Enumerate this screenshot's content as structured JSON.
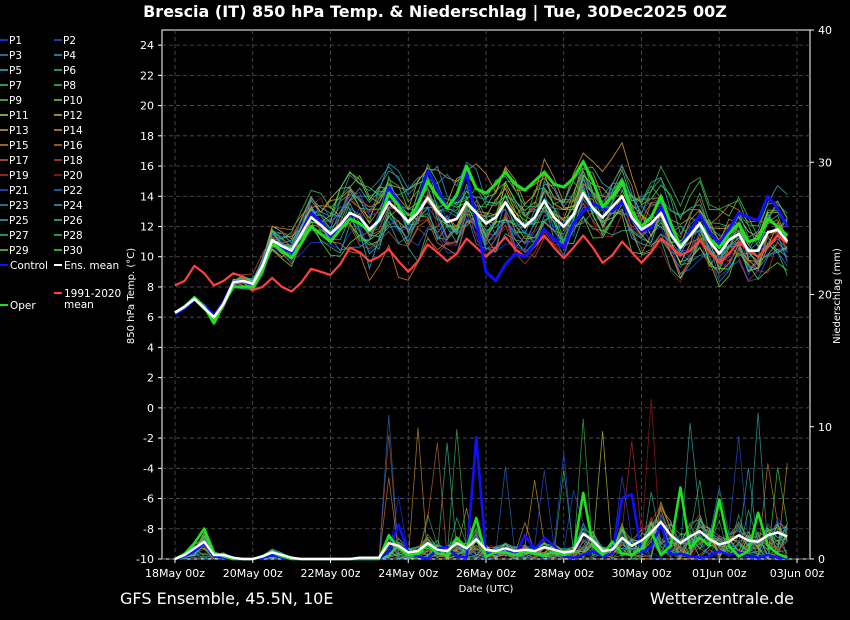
{
  "header": {
    "title": "Brescia  (IT)  850 hPa Temp. & Niederschlag | Tue, 30Dec2025 00Z"
  },
  "footer": {
    "left": "GFS Ensemble, 45.5N, 10E",
    "right": "Wetterzentrale.de"
  },
  "chart_data": {
    "type": "line",
    "title": "Brescia  (IT)  850 hPa Temp. & Niederschlag | Tue, 30Dec2025 00Z",
    "xlabel": "Date (UTC)",
    "ylabel": "850 hPa Temp. (°C)",
    "y2label": "Niederschlag (mm)",
    "ylim": [
      -10,
      25
    ],
    "y2lim": [
      0,
      40
    ],
    "yticks": [
      -10,
      -8,
      -6,
      -4,
      -2,
      0,
      2,
      4,
      6,
      8,
      10,
      12,
      14,
      16,
      18,
      20,
      22,
      24
    ],
    "y2ticks": [
      0,
      10,
      20,
      30,
      40
    ],
    "xticks": [
      "18May 00z",
      "20May 00z",
      "22May 00z",
      "24May 00z",
      "26May 00z",
      "28May 00z",
      "30May 00z",
      "01Jun 00z",
      "03Jun 00z"
    ],
    "x_days": 16,
    "grid": true,
    "legend": {
      "placement": "left",
      "entries": [
        {
          "name": "P1",
          "color": "#1e3cff"
        },
        {
          "name": "P2",
          "color": "#2850e0"
        },
        {
          "name": "P3",
          "color": "#3a86c8"
        },
        {
          "name": "P4",
          "color": "#2a9bd6"
        },
        {
          "name": "P5",
          "color": "#30b8b8"
        },
        {
          "name": "P6",
          "color": "#2fc08a"
        },
        {
          "name": "P7",
          "color": "#3ac0a0"
        },
        {
          "name": "P8",
          "color": "#3cc060"
        },
        {
          "name": "P9",
          "color": "#52d040"
        },
        {
          "name": "P10",
          "color": "#7ad030"
        },
        {
          "name": "P11",
          "color": "#c8c840"
        },
        {
          "name": "P12",
          "color": "#d8b040"
        },
        {
          "name": "P13",
          "color": "#d8a030"
        },
        {
          "name": "P14",
          "color": "#d89030"
        },
        {
          "name": "P15",
          "color": "#d88030"
        },
        {
          "name": "P16",
          "color": "#c87030"
        },
        {
          "name": "P17",
          "color": "#c86840"
        },
        {
          "name": "P18",
          "color": "#b85030"
        },
        {
          "name": "P19",
          "color": "#c03030"
        },
        {
          "name": "P20",
          "color": "#a02020"
        },
        {
          "name": "P21",
          "color": "#3050e8"
        },
        {
          "name": "P22",
          "color": "#2a70d0"
        },
        {
          "name": "P23",
          "color": "#3090c8"
        },
        {
          "name": "P24",
          "color": "#28a8c8"
        },
        {
          "name": "P25",
          "color": "#30b0b0"
        },
        {
          "name": "P26",
          "color": "#30c098"
        },
        {
          "name": "P27",
          "color": "#30c070"
        },
        {
          "name": "P28",
          "color": "#40c050"
        },
        {
          "name": "P29",
          "color": "#60d040"
        },
        {
          "name": "P30",
          "color": "#40e040"
        },
        {
          "name": "Control",
          "color": "#1010ff"
        },
        {
          "name": "Ens. mean",
          "color": "#ffffff"
        },
        {
          "name": "1991-2020 mean",
          "color": "#ff4040"
        },
        {
          "name": "Oper",
          "color": "#20e020"
        }
      ]
    },
    "series": [
      {
        "name": "Control",
        "color": "#1010ff",
        "step_hours": 6,
        "values": [
          6.2,
          6.6,
          7.2,
          6.8,
          6.1,
          7.0,
          8.3,
          8.4,
          8.1,
          9.3,
          11.0,
          10.6,
          10.3,
          11.6,
          12.9,
          12.3,
          11.4,
          12.0,
          12.8,
          12.6,
          11.8,
          12.4,
          14.6,
          13.6,
          12.1,
          13.5,
          15.7,
          14.5,
          13.2,
          14.0,
          15.6,
          12.3,
          9.0,
          8.4,
          9.5,
          10.2,
          10.0,
          10.8,
          11.8,
          11.2,
          10.6,
          12.2,
          13.0,
          13.5,
          13.2,
          13.0,
          13.6,
          12.5,
          11.7,
          11.9,
          13.3,
          11.8,
          10.8,
          11.6,
          12.8,
          11.6,
          10.9,
          11.8,
          12.9,
          12.6,
          12.4,
          14.0,
          13.2,
          12.0
        ]
      },
      {
        "name": "Oper",
        "color": "#20e020",
        "step_hours": 6,
        "values": [
          6.3,
          6.7,
          7.3,
          6.7,
          5.6,
          6.9,
          8.0,
          8.0,
          8.0,
          9.2,
          10.9,
          10.4,
          9.9,
          10.9,
          12.0,
          11.5,
          11.0,
          11.8,
          12.5,
          12.2,
          11.7,
          12.4,
          14.2,
          13.4,
          12.2,
          13.5,
          15.0,
          14.0,
          13.2,
          14.1,
          16.0,
          14.5,
          14.2,
          14.8,
          15.6,
          14.8,
          14.4,
          15.0,
          15.6,
          14.8,
          14.6,
          15.2,
          16.3,
          15.0,
          13.3,
          14.0,
          15.0,
          13.0,
          12.0,
          12.6,
          14.0,
          12.2,
          10.7,
          11.4,
          12.2,
          11.2,
          10.6,
          11.5,
          12.2,
          11.0,
          11.2,
          12.5,
          12.0,
          11.4
        ]
      },
      {
        "name": "Ens. mean",
        "color": "#ffffff",
        "step_hours": 6,
        "values": [
          6.3,
          6.7,
          7.2,
          6.6,
          6.0,
          6.9,
          8.3,
          8.4,
          8.2,
          9.4,
          11.1,
          10.7,
          10.4,
          11.5,
          12.6,
          12.1,
          11.5,
          12.1,
          12.9,
          12.6,
          11.8,
          12.4,
          13.6,
          13.0,
          12.3,
          12.9,
          13.9,
          13.0,
          12.3,
          12.5,
          13.6,
          12.9,
          12.2,
          12.6,
          13.6,
          12.6,
          12.0,
          12.6,
          13.7,
          12.6,
          12.0,
          12.8,
          14.2,
          13.2,
          12.6,
          13.3,
          14.0,
          12.6,
          11.8,
          12.2,
          12.9,
          11.5,
          10.6,
          11.4,
          12.2,
          11.0,
          10.2,
          11.1,
          11.5,
          10.4,
          10.4,
          11.6,
          11.8,
          11.0
        ]
      },
      {
        "name": "1991-2020 mean",
        "color": "#ff4040",
        "step_hours": 6,
        "values": [
          8.1,
          8.4,
          9.4,
          8.9,
          8.1,
          8.4,
          8.9,
          8.7,
          7.8,
          8.0,
          8.6,
          8.0,
          7.7,
          8.3,
          9.2,
          9.0,
          8.8,
          9.5,
          10.6,
          10.3,
          9.7,
          10.0,
          10.5,
          9.7,
          9.0,
          9.7,
          10.8,
          10.3,
          9.7,
          10.2,
          11.2,
          10.6,
          10.0,
          10.6,
          11.3,
          10.5,
          10.0,
          10.7,
          11.4,
          10.6,
          9.9,
          10.6,
          11.4,
          10.6,
          9.6,
          10.1,
          11.0,
          10.3,
          9.6,
          10.3,
          11.2,
          10.7,
          10.1,
          10.4,
          11.1,
          10.3,
          9.6,
          10.2,
          11.0,
          10.4,
          10.0,
          10.6,
          11.4,
          10.9
        ]
      },
      {
        "name": "Control precipitation",
        "color": "#1010ff",
        "axis": "y2",
        "step_hours": 6,
        "values": [
          0,
          0.2,
          0.6,
          1.2,
          0.2,
          0.1,
          0,
          0,
          0,
          0.1,
          0.3,
          0.1,
          0,
          0,
          0,
          0,
          0,
          0,
          0,
          0,
          0,
          0,
          0.6,
          2.6,
          0.5,
          0.2,
          0,
          0.8,
          0.9,
          0.2,
          0.1,
          9.2,
          0.4,
          0.4,
          0.8,
          0.3,
          1.8,
          0.7,
          1.6,
          1.0,
          0.2,
          0.1,
          0.3,
          0.6,
          0.2,
          0.4,
          4.6,
          4.9,
          0.5,
          0.9,
          2.6,
          0.3,
          0.4,
          0.2,
          0.1,
          0.2,
          0.6,
          0.3,
          0.5,
          0.2,
          0.1,
          0.3,
          0.1,
          0.1
        ]
      },
      {
        "name": "Oper precipitation",
        "color": "#20e020",
        "axis": "y2",
        "step_hours": 6,
        "values": [
          0,
          0.4,
          1.2,
          2.3,
          0.5,
          0.2,
          0,
          0,
          0,
          0.2,
          0.5,
          0.2,
          0,
          0,
          0,
          0,
          0,
          0,
          0,
          0,
          0,
          0,
          1.8,
          0.8,
          0.3,
          0.4,
          1.1,
          0.4,
          0.3,
          1.6,
          0.8,
          3.1,
          0.2,
          0.5,
          0.5,
          0.3,
          0.6,
          0.4,
          0.3,
          0.5,
          0.3,
          0.5,
          5.0,
          1.0,
          0.3,
          1.3,
          0.4,
          0.3,
          0.8,
          2.1,
          0.3,
          1.0,
          5.4,
          0.8,
          1.6,
          1.0,
          4.5,
          1.0,
          0.2,
          0.6,
          3.5,
          1.0,
          0.4,
          0.1
        ]
      },
      {
        "name": "Ens. mean precipitation",
        "color": "#ffffff",
        "axis": "y2",
        "step_hours": 6,
        "values": [
          0,
          0.3,
          0.8,
          1.3,
          0.3,
          0.3,
          0.1,
          0,
          0,
          0.2,
          0.5,
          0.3,
          0.1,
          0,
          0,
          0,
          0,
          0,
          0,
          0.1,
          0.1,
          0.1,
          1.2,
          1.0,
          0.5,
          0.6,
          1.2,
          0.7,
          0.6,
          1.2,
          0.8,
          1.5,
          0.7,
          0.6,
          0.8,
          0.6,
          0.7,
          0.6,
          0.9,
          0.7,
          0.5,
          0.6,
          1.9,
          1.4,
          0.6,
          0.7,
          1.6,
          1.0,
          1.4,
          2.0,
          2.8,
          1.8,
          1.2,
          1.7,
          2.1,
          1.5,
          1.1,
          1.3,
          1.8,
          1.4,
          1.3,
          1.8,
          2.0,
          1.7
        ]
      }
    ]
  }
}
